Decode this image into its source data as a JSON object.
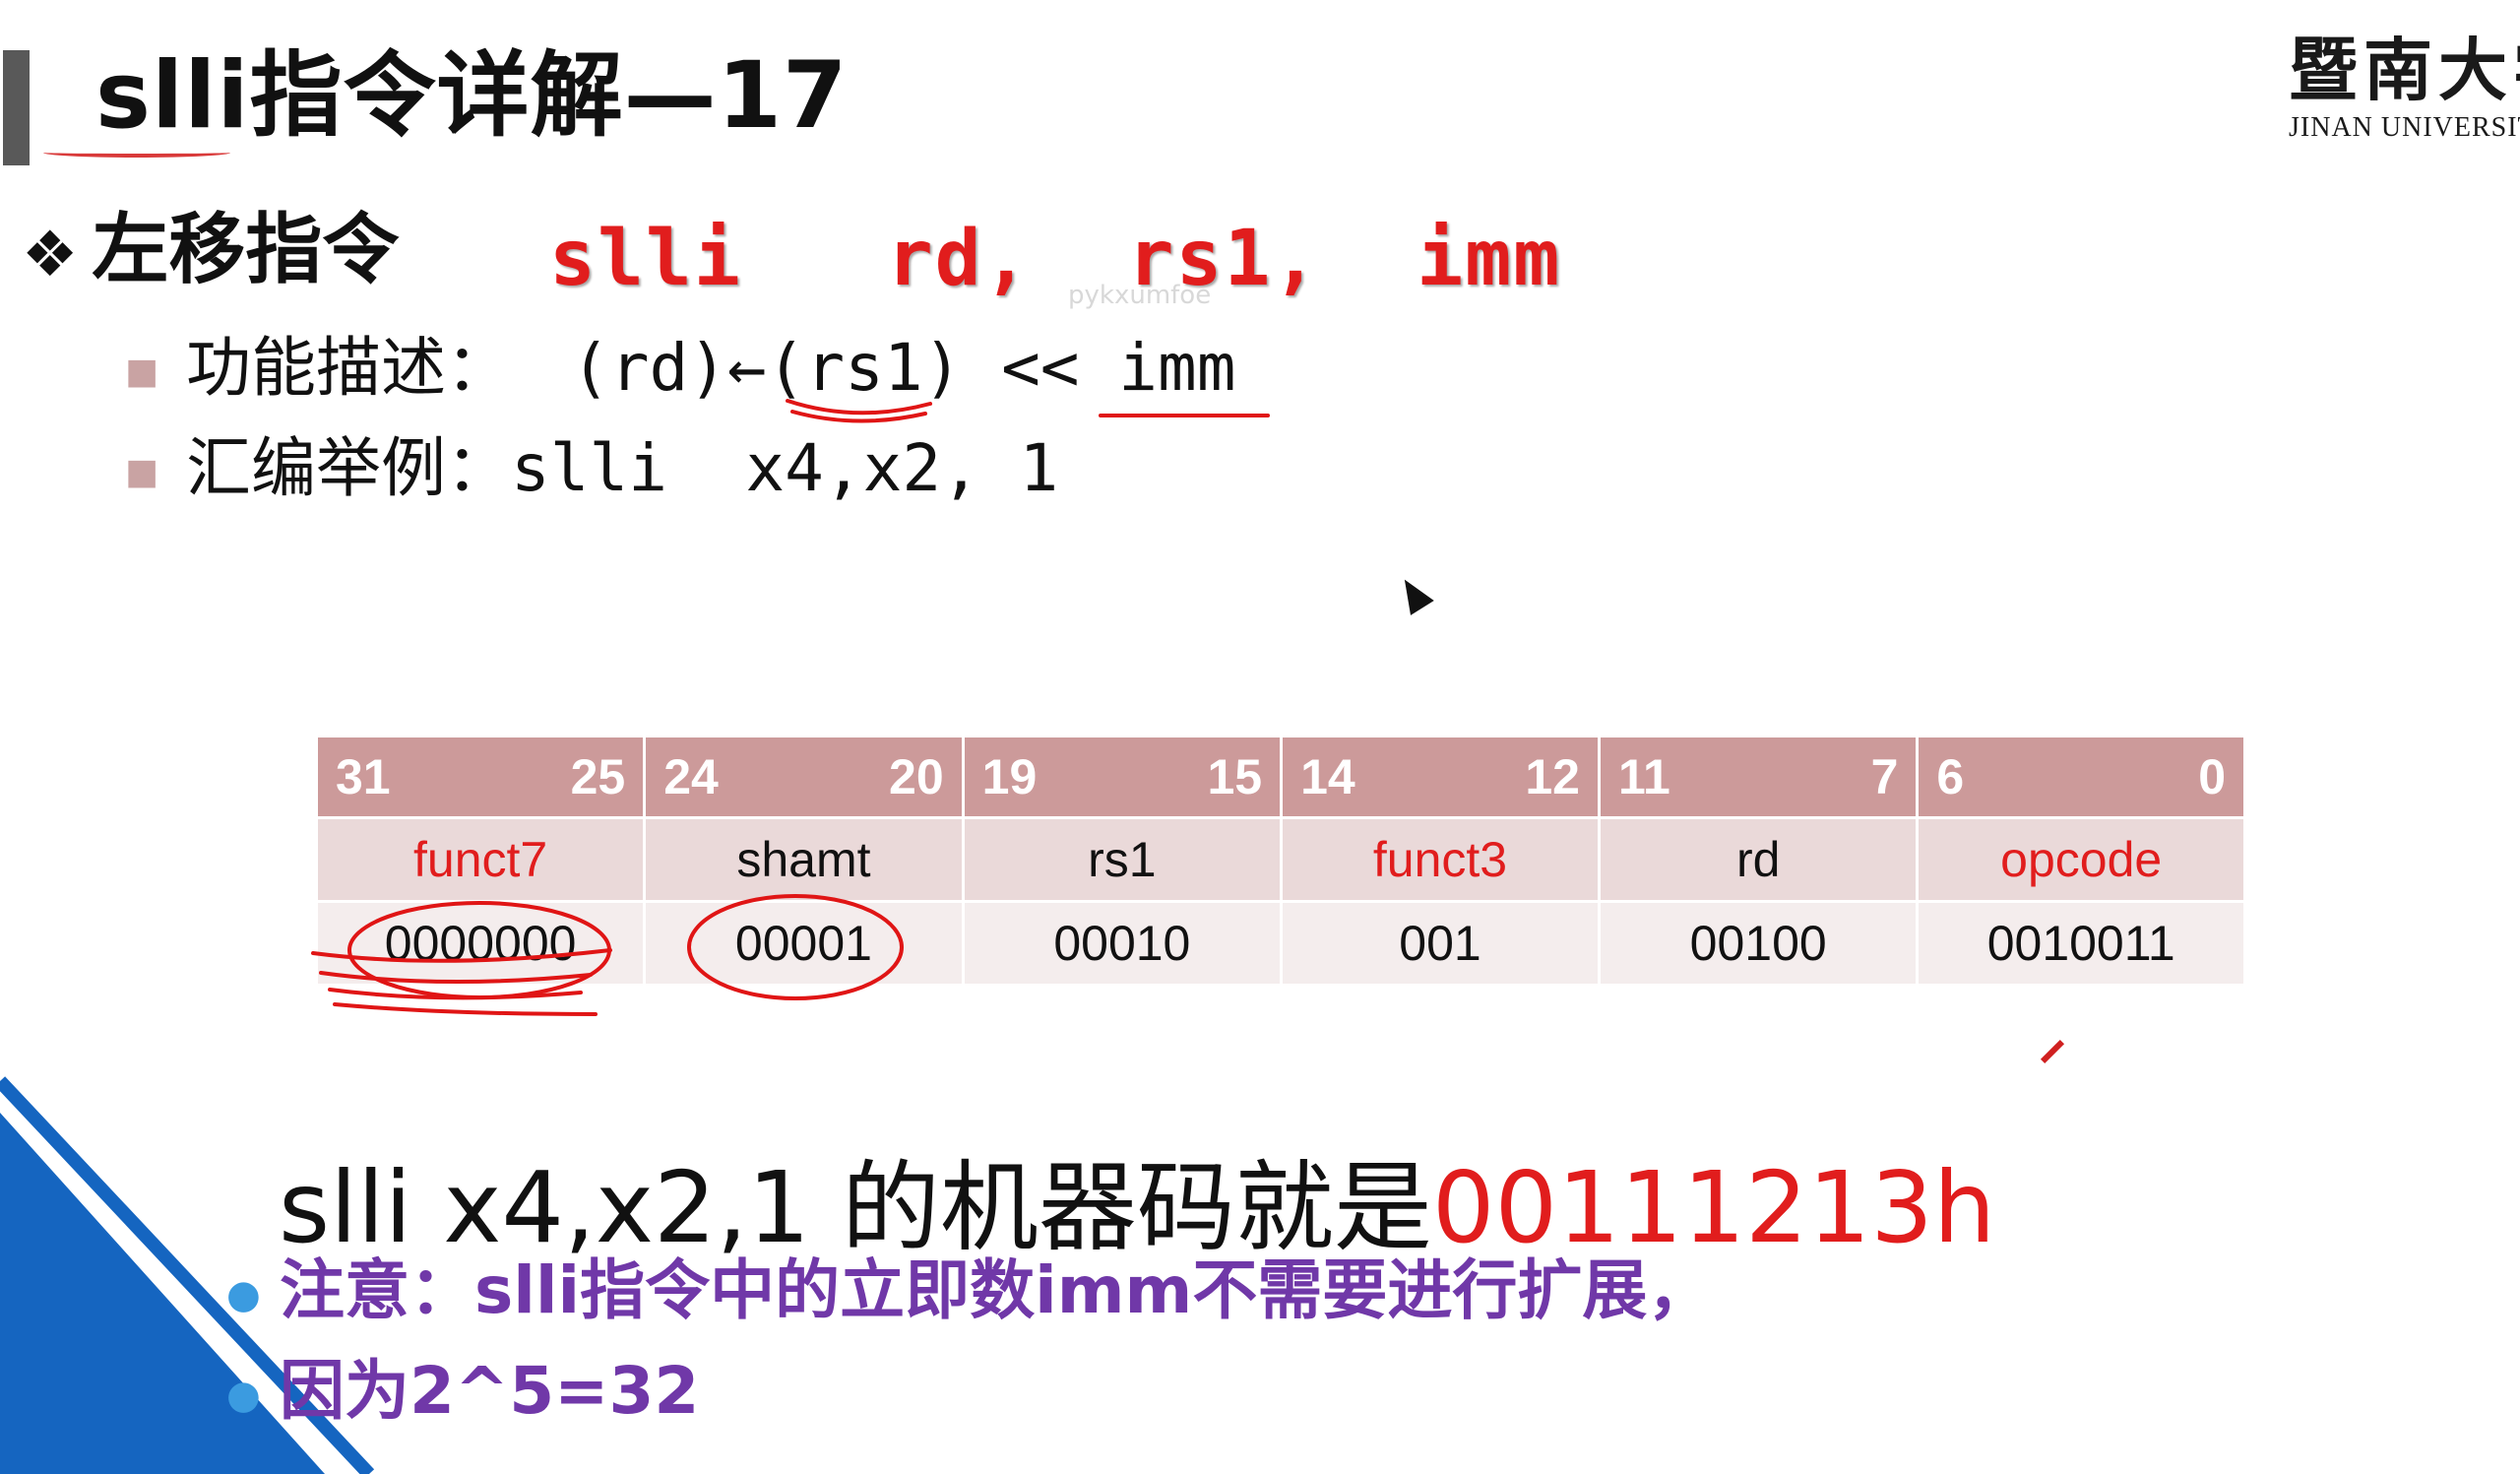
{
  "slide": {
    "title": "slli指令详解—17",
    "logo": {
      "cn": "暨南大学",
      "en": "JINAN UNIVERSITY"
    },
    "main_bullet": {
      "label": "左移指令",
      "syntax": "slli   rd,  rs1,  imm"
    },
    "watermark": "pykxumfoe",
    "func_desc": {
      "label": "功能描述：",
      "value": "(rd)←(rs1) << imm"
    },
    "asm_example": {
      "label": "汇编举例：",
      "value": "slli  x4,x2, 1"
    },
    "encoding": {
      "bit_ranges": [
        {
          "hi": "31",
          "lo": "25"
        },
        {
          "hi": "24",
          "lo": "20"
        },
        {
          "hi": "19",
          "lo": "15"
        },
        {
          "hi": "14",
          "lo": "12"
        },
        {
          "hi": "11",
          "lo": "7"
        },
        {
          "hi": "6",
          "lo": "0"
        }
      ],
      "fields": [
        "funct7",
        "shamt",
        "rs1",
        "funct3",
        "rd",
        "opcode"
      ],
      "values": [
        "0000000",
        "00001",
        "00010",
        "001",
        "00100",
        "0010011"
      ]
    },
    "machine_code": {
      "prefix": "slli x4,x2,1 的机器码就是",
      "code": "00111213h"
    },
    "notes": [
      "注意：slli指令中的立即数imm不需要进行扩展，",
      "因为2^5=32"
    ]
  },
  "colors": {
    "red": "#e11d1d",
    "header_bg": "#cc9a9a",
    "row1_bg": "#ead9d9",
    "row2_bg": "#f4eded",
    "note_purple": "#7038a8",
    "corner_blue": "#1565c0"
  }
}
